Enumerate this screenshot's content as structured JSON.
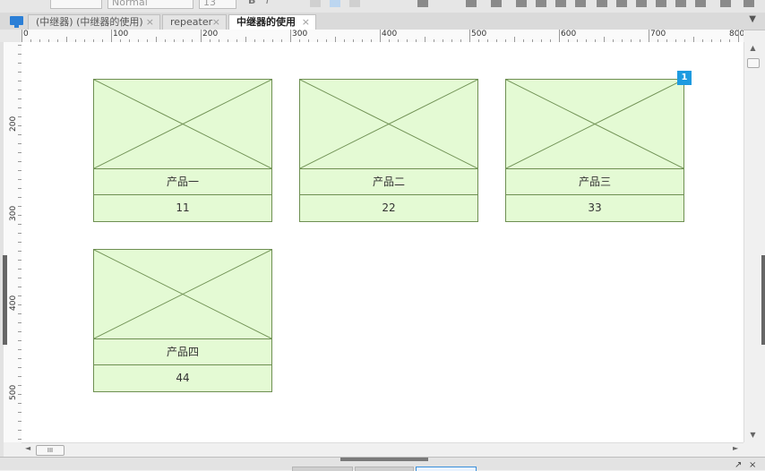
{
  "toolbar": {
    "font_style_value": "Normal",
    "font_size_value": "13",
    "bold_label": "B",
    "italic_label": "I"
  },
  "tabs": [
    {
      "label": "(中继器) (中继器的使用)",
      "close": "×"
    },
    {
      "label": "repeater",
      "close": "×"
    },
    {
      "label": "中继器的使用",
      "close": "×"
    }
  ],
  "tab_menu_glyph": "▼",
  "ruler": {
    "h_labels": [
      "0",
      "100",
      "200",
      "300",
      "400",
      "500",
      "600",
      "700",
      "800"
    ],
    "v_labels": [
      "200",
      "300",
      "400",
      "500"
    ]
  },
  "repeater": {
    "badge": "1",
    "items": [
      {
        "name": "产品一",
        "price": "11"
      },
      {
        "name": "产品二",
        "price": "22"
      },
      {
        "name": "产品三",
        "price": "33"
      },
      {
        "name": "产品四",
        "price": "44"
      }
    ]
  },
  "scroll": {
    "up": "▲",
    "down": "▼",
    "left": "◄",
    "right": "►",
    "thumb_grip": "III"
  },
  "status": {
    "pin_glyph": "↗",
    "close_glyph": "×"
  },
  "colors": {
    "card_fill": "#e4fad4",
    "card_border": "#6e8f52",
    "badge": "#1e9be0",
    "active_tab": "#ffffff"
  }
}
